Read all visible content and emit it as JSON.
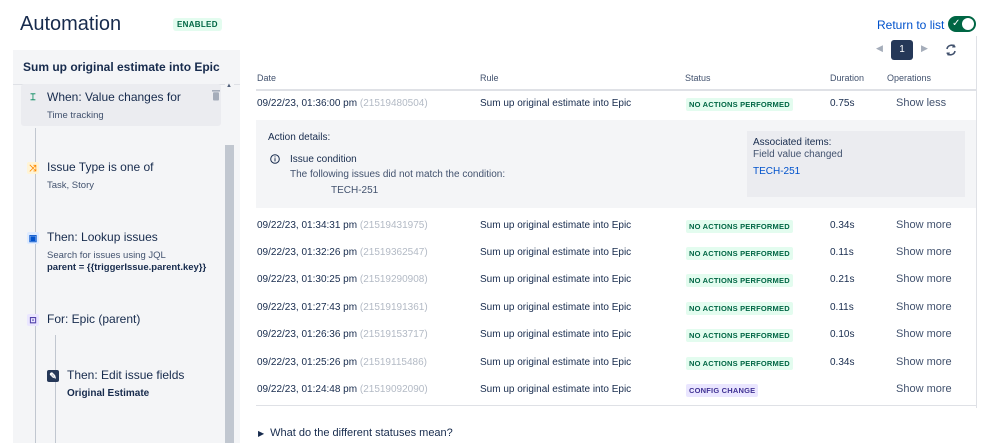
{
  "header": {
    "title": "Automation",
    "enabled_badge": "ENABLED",
    "return_link": "Return to list",
    "toggle_check": "✓"
  },
  "sidebar": {
    "title": "Sum up original estimate into Epic",
    "items": [
      {
        "title": "When: Value changes for",
        "sub": "Time tracking",
        "icon": "trigger-icon",
        "icon_color": "#00875a"
      },
      {
        "title": "Issue Type is one of",
        "sub": "Task, Story",
        "icon": "condition-icon",
        "icon_color": "#ff991f"
      },
      {
        "title": "Then: Lookup issues",
        "sub": "Search for issues using JQL",
        "sub2_label": "parent",
        "sub2_value": "= {{triggerIssue.parent.key}}",
        "icon": "lookup-icon",
        "icon_color": "#0052cc"
      },
      {
        "title": "For: Epic (parent)",
        "icon": "branch-icon",
        "icon_color": "#6554c0"
      },
      {
        "title": "Then: Edit issue fields",
        "sub": "Original Estimate",
        "icon": "edit-icon",
        "icon_color": "#0052cc"
      }
    ]
  },
  "pagination": {
    "current_page": "1"
  },
  "table": {
    "columns": [
      "Date",
      "Rule",
      "Status",
      "Duration",
      "Operations"
    ],
    "rows": [
      {
        "date": "09/22/23, 01:36:00 pm",
        "id": "(21519480504)",
        "rule": "Sum up original estimate into Epic",
        "status": "NO ACTIONS PERFORMED",
        "status_type": "ok",
        "duration": "0.75s",
        "op": "Show less"
      },
      {
        "date": "09/22/23, 01:34:31 pm",
        "id": "(21519431975)",
        "rule": "Sum up original estimate into Epic",
        "status": "NO ACTIONS PERFORMED",
        "status_type": "ok",
        "duration": "0.34s",
        "op": "Show more"
      },
      {
        "date": "09/22/23, 01:32:26 pm",
        "id": "(21519362547)",
        "rule": "Sum up original estimate into Epic",
        "status": "NO ACTIONS PERFORMED",
        "status_type": "ok",
        "duration": "0.11s",
        "op": "Show more"
      },
      {
        "date": "09/22/23, 01:30:25 pm",
        "id": "(21519290908)",
        "rule": "Sum up original estimate into Epic",
        "status": "NO ACTIONS PERFORMED",
        "status_type": "ok",
        "duration": "0.21s",
        "op": "Show more"
      },
      {
        "date": "09/22/23, 01:27:43 pm",
        "id": "(21519191361)",
        "rule": "Sum up original estimate into Epic",
        "status": "NO ACTIONS PERFORMED",
        "status_type": "ok",
        "duration": "0.11s",
        "op": "Show more"
      },
      {
        "date": "09/22/23, 01:26:36 pm",
        "id": "(21519153717)",
        "rule": "Sum up original estimate into Epic",
        "status": "NO ACTIONS PERFORMED",
        "status_type": "ok",
        "duration": "0.10s",
        "op": "Show more"
      },
      {
        "date": "09/22/23, 01:25:26 pm",
        "id": "(21519115486)",
        "rule": "Sum up original estimate into Epic",
        "status": "NO ACTIONS PERFORMED",
        "status_type": "ok",
        "duration": "0.34s",
        "op": "Show more"
      },
      {
        "date": "09/22/23, 01:24:48 pm",
        "id": "(21519092090)",
        "rule": "Sum up original estimate into Epic",
        "status": "CONFIG CHANGE",
        "status_type": "config",
        "duration": "",
        "op": "Show more"
      }
    ]
  },
  "details": {
    "title": "Action details:",
    "condition": "Issue condition",
    "message": "The following issues did not match the condition:",
    "issue": "TECH-251",
    "assoc_title": "Associated items:",
    "assoc_sub": "Field value changed",
    "assoc_link": "TECH-251"
  },
  "faq": {
    "label": "What do the different statuses mean?"
  }
}
